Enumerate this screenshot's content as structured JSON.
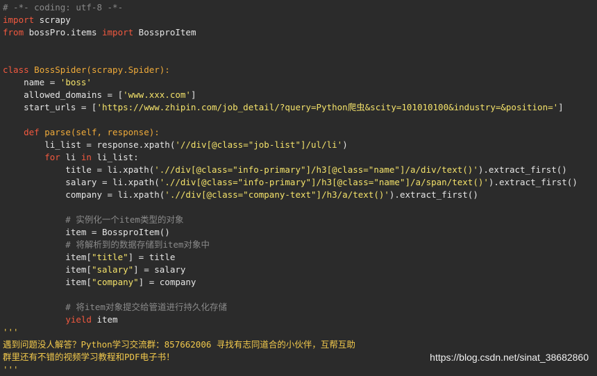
{
  "code": {
    "lines": [
      [
        {
          "t": "# -*- coding: utf-8 -*-",
          "c": "cm"
        }
      ],
      [
        {
          "t": "import",
          "c": "kw"
        },
        {
          "t": " scrapy",
          "c": "pl"
        }
      ],
      [
        {
          "t": "from",
          "c": "kw"
        },
        {
          "t": " bossPro.items ",
          "c": "pl"
        },
        {
          "t": "import",
          "c": "kw"
        },
        {
          "t": " BossproItem",
          "c": "pl"
        }
      ],
      [],
      [],
      [
        {
          "t": "class",
          "c": "kw"
        },
        {
          "t": " BossSpider(scrapy.Spider):",
          "c": "def"
        }
      ],
      [
        {
          "t": "    name = ",
          "c": "pl"
        },
        {
          "t": "'boss'",
          "c": "st"
        }
      ],
      [
        {
          "t": "    allowed_domains = [",
          "c": "pl"
        },
        {
          "t": "'www.xxx.com'",
          "c": "st"
        },
        {
          "t": "]",
          "c": "pl"
        }
      ],
      [
        {
          "t": "    start_urls = [",
          "c": "pl"
        },
        {
          "t": "'https://www.zhipin.com/job_detail/?query=Python爬虫&scity=101010100&industry=&position='",
          "c": "st"
        },
        {
          "t": "]",
          "c": "pl"
        }
      ],
      [],
      [
        {
          "t": "    ",
          "c": "pl"
        },
        {
          "t": "def",
          "c": "kw"
        },
        {
          "t": " parse(self, response):",
          "c": "def"
        }
      ],
      [
        {
          "t": "        li_list = response.xpath(",
          "c": "pl"
        },
        {
          "t": "'//div[@class=\"job-list\"]/ul/li'",
          "c": "st"
        },
        {
          "t": ")",
          "c": "pl"
        }
      ],
      [
        {
          "t": "        ",
          "c": "pl"
        },
        {
          "t": "for",
          "c": "kw"
        },
        {
          "t": " li ",
          "c": "pl"
        },
        {
          "t": "in",
          "c": "kw"
        },
        {
          "t": " li_list:",
          "c": "pl"
        }
      ],
      [
        {
          "t": "            title = li.xpath(",
          "c": "pl"
        },
        {
          "t": "'.//div[@class=\"info-primary\"]/h3[@class=\"name\"]/a/div/text()'",
          "c": "st"
        },
        {
          "t": ").extract_first()",
          "c": "pl"
        }
      ],
      [
        {
          "t": "            salary = li.xpath(",
          "c": "pl"
        },
        {
          "t": "'.//div[@class=\"info-primary\"]/h3[@class=\"name\"]/a/span/text()'",
          "c": "st"
        },
        {
          "t": ").extract_first()",
          "c": "pl"
        }
      ],
      [
        {
          "t": "            company = li.xpath(",
          "c": "pl"
        },
        {
          "t": "'.//div[@class=\"company-text\"]/h3/a/text()'",
          "c": "st"
        },
        {
          "t": ").extract_first()",
          "c": "pl"
        }
      ],
      [],
      [
        {
          "t": "            # 实例化一个item类型的对象",
          "c": "cm"
        }
      ],
      [
        {
          "t": "            item = BossproItem()",
          "c": "pl"
        }
      ],
      [
        {
          "t": "            # 将解析到的数据存储到item对象中",
          "c": "cm"
        }
      ],
      [
        {
          "t": "            item[",
          "c": "pl"
        },
        {
          "t": "\"title\"",
          "c": "st"
        },
        {
          "t": "] = title",
          "c": "pl"
        }
      ],
      [
        {
          "t": "            item[",
          "c": "pl"
        },
        {
          "t": "\"salary\"",
          "c": "st"
        },
        {
          "t": "] = salary",
          "c": "pl"
        }
      ],
      [
        {
          "t": "            item[",
          "c": "pl"
        },
        {
          "t": "\"company\"",
          "c": "st"
        },
        {
          "t": "] = company",
          "c": "pl"
        }
      ],
      [],
      [
        {
          "t": "            # 将item对象提交给管道进行持久化存储",
          "c": "cm"
        }
      ],
      [
        {
          "t": "            ",
          "c": "pl"
        },
        {
          "t": "yield",
          "c": "kw"
        },
        {
          "t": " item",
          "c": "pl"
        }
      ],
      [
        {
          "t": "'''",
          "c": "yl"
        }
      ],
      [
        {
          "t": "遇到问题没人解答？Python学习交流群：857662006 寻找有志同道合的小伙伴，互帮互助",
          "c": "cn"
        }
      ],
      [
        {
          "t": "群里还有不错的视频学习教程和PDF电子书！",
          "c": "cn"
        }
      ],
      [
        {
          "t": "'''",
          "c": "yl"
        }
      ]
    ]
  },
  "watermark": "https://blog.csdn.net/sinat_38682860"
}
